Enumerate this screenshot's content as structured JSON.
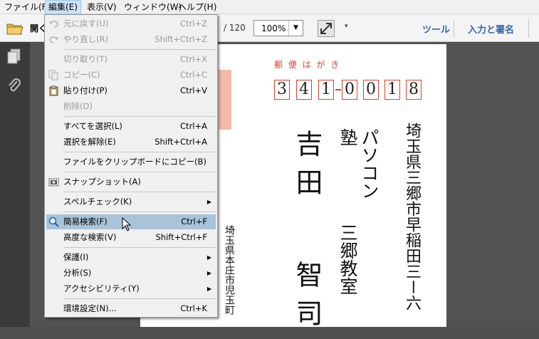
{
  "menubar": {
    "items": [
      "ファイル(F)",
      "編集(E)",
      "表示(V)",
      "ウィンドウ(W)",
      "ヘルプ(H)"
    ]
  },
  "toolbar": {
    "open_label": "開く",
    "page_total": "/ 120",
    "zoom_value": "100%",
    "tools_label": "ツール",
    "sign_label": "入力と署名"
  },
  "edit_menu": {
    "undo": {
      "label": "元に戻す(U)",
      "shortcut": "Ctrl+Z"
    },
    "redo": {
      "label": "やり直し(R)",
      "shortcut": "Shift+Ctrl+Z"
    },
    "cut": {
      "label": "切り取り(T)",
      "shortcut": "Ctrl+X"
    },
    "copy": {
      "label": "コピー(C)",
      "shortcut": "Ctrl+C"
    },
    "paste": {
      "label": "貼り付け(P)",
      "shortcut": "Ctrl+V"
    },
    "delete": {
      "label": "削除(D)"
    },
    "select_all": {
      "label": "すべてを選択(L)",
      "shortcut": "Ctrl+A"
    },
    "deselect": {
      "label": "選択を解除(E)",
      "shortcut": "Shift+Ctrl+A"
    },
    "copy_file": {
      "label": "ファイルをクリップボードにコピー(B)"
    },
    "snapshot": {
      "label": "スナップショット(A)"
    },
    "spellcheck": {
      "label": "スペルチェック(K)"
    },
    "find": {
      "label": "簡易検索(F)",
      "shortcut": "Ctrl+F"
    },
    "adv_search": {
      "label": "高度な検索(V)",
      "shortcut": "Shift+Ctrl+F"
    },
    "protect": {
      "label": "保護(I)"
    },
    "analyze": {
      "label": "分析(S)"
    },
    "accessibility": {
      "label": "アクセシビリティ(Y)"
    },
    "prefs": {
      "label": "環境設定(N)...",
      "shortcut": "Ctrl+K"
    }
  },
  "document": {
    "postcard_header": "郵 便 は が き",
    "zip_digits": [
      "3",
      "4",
      "1",
      "0",
      "0",
      "1",
      "8"
    ],
    "address": "埼玉県三郷市早稲田三ー六",
    "org_line1": "パソコン塾",
    "org_line2": "三郷教室",
    "name_col1": "吉田",
    "name_col2": "智司",
    "sender_address": "埼玉県本庄市児玉町"
  }
}
